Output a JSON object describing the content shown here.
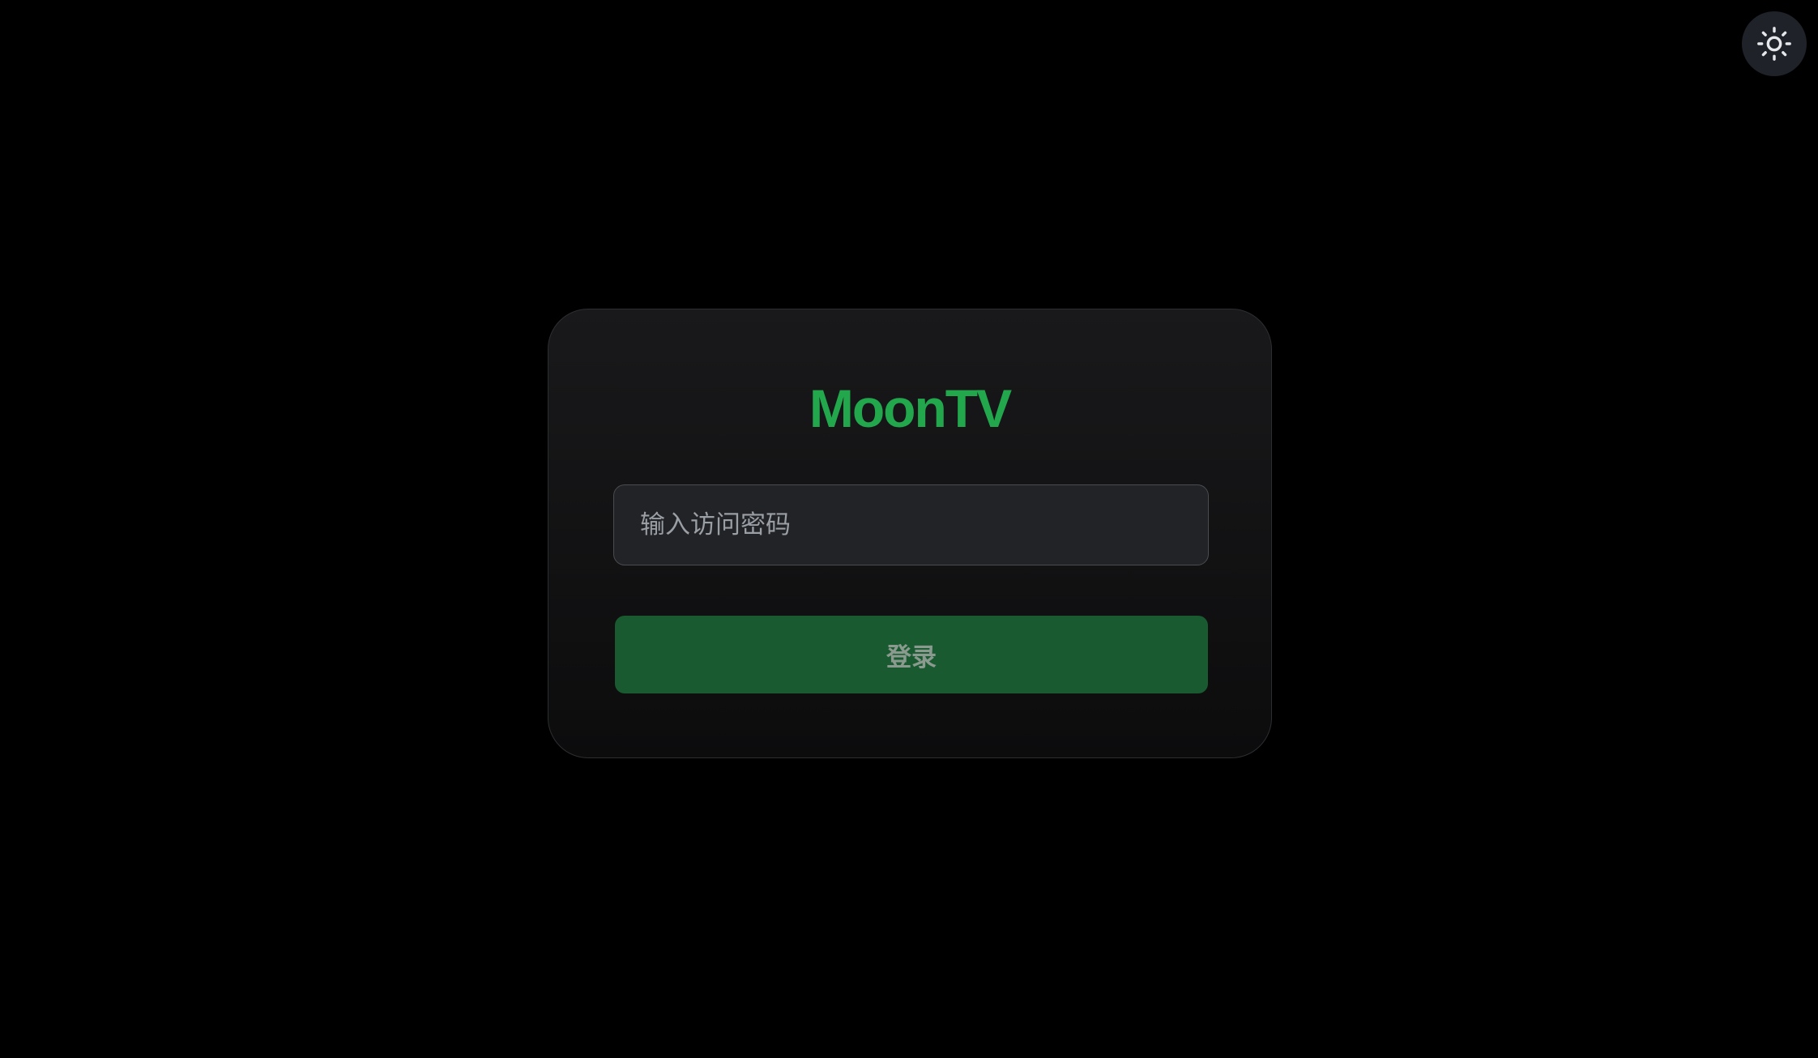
{
  "header": {
    "theme_toggle_icon": "sun-icon"
  },
  "login": {
    "brand": "MoonTV",
    "password_placeholder": "输入访问密码",
    "password_value": "",
    "submit_label": "登录"
  },
  "colors": {
    "background": "#000000",
    "brand_green": "#22a74d",
    "button_green": "#1a5a30",
    "card_background": "#161618",
    "toggle_background": "#1f2329"
  }
}
